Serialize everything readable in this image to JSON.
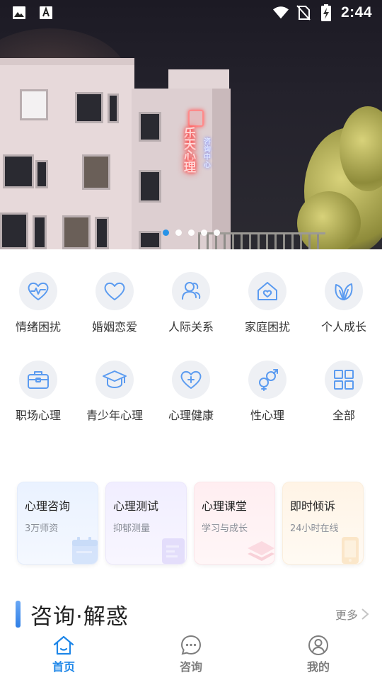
{
  "status_bar": {
    "time": "2:44",
    "left_icons": [
      "image-icon",
      "font-icon"
    ],
    "right_icons": [
      "wifi-icon",
      "no-sim-icon",
      "battery-charging-icon"
    ]
  },
  "banner": {
    "sign_text": "乐天心理",
    "sign_sub": "咨询中心",
    "slide_count": 5,
    "active_slide": 1
  },
  "categories": [
    {
      "label": "情绪困扰",
      "icon": "heartbeat-icon"
    },
    {
      "label": "婚姻恋爱",
      "icon": "heart-icon"
    },
    {
      "label": "人际关系",
      "icon": "people-icon"
    },
    {
      "label": "家庭困扰",
      "icon": "house-heart-icon"
    },
    {
      "label": "个人成长",
      "icon": "leaf-icon"
    },
    {
      "label": "职场心理",
      "icon": "briefcase-icon"
    },
    {
      "label": "青少年心理",
      "icon": "graduation-cap-icon"
    },
    {
      "label": "心理健康",
      "icon": "heart-plus-icon"
    },
    {
      "label": "性心理",
      "icon": "gender-icon"
    },
    {
      "label": "全部",
      "icon": "grid-icon"
    }
  ],
  "service_cards": [
    {
      "title": "心理咨询",
      "subtitle": "3万师资",
      "theme": "blue",
      "icon": "calendar-icon"
    },
    {
      "title": "心理测试",
      "subtitle": "抑郁测量",
      "theme": "purple",
      "icon": "test-paper-icon"
    },
    {
      "title": "心理课堂",
      "subtitle": "学习与成长",
      "theme": "pink",
      "icon": "layers-icon"
    },
    {
      "title": "即时倾诉",
      "subtitle": "24小时在线",
      "theme": "orange",
      "icon": "phone-icon"
    }
  ],
  "section": {
    "title": "咨询·解惑",
    "more_label": "更多"
  },
  "bottom_nav": [
    {
      "label": "首页",
      "icon": "home-icon",
      "active": true
    },
    {
      "label": "咨询",
      "icon": "chat-icon",
      "active": false
    },
    {
      "label": "我的",
      "icon": "user-icon",
      "active": false
    }
  ],
  "colors": {
    "accent": "#1d86e8",
    "icon_stroke": "#5b9bf0",
    "icon_bg": "#eef0f4",
    "carousel_active": "#1e8fe8"
  }
}
